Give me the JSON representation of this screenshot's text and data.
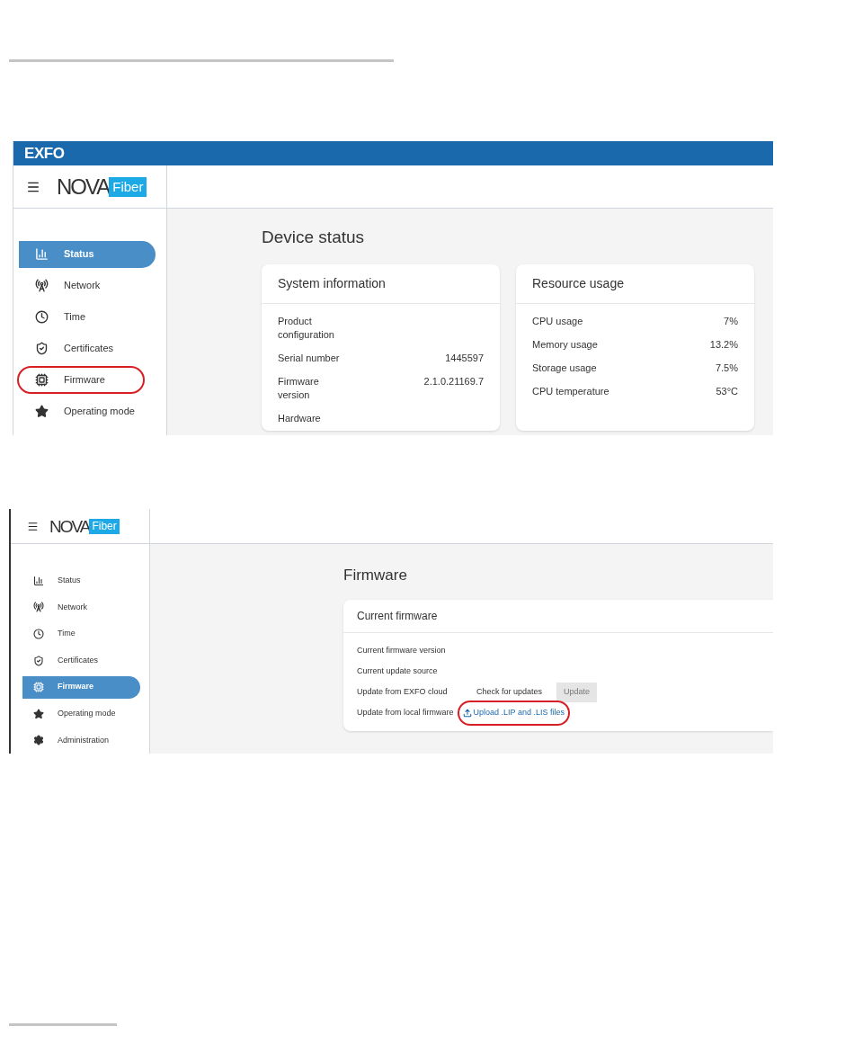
{
  "device_status_screen": {
    "brand": "EXFO",
    "logo": {
      "word": "NOVA",
      "badge": "Fiber"
    },
    "nav": [
      {
        "label": "Status",
        "kind": "chart",
        "selected": true,
        "highlighted": false
      },
      {
        "label": "Network",
        "kind": "antenna",
        "selected": false,
        "highlighted": false
      },
      {
        "label": "Time",
        "kind": "clock",
        "selected": false,
        "highlighted": false
      },
      {
        "label": "Certificates",
        "kind": "shield",
        "selected": false,
        "highlighted": false
      },
      {
        "label": "Firmware",
        "kind": "chip",
        "selected": false,
        "highlighted": true
      },
      {
        "label": "Operating mode",
        "kind": "star",
        "selected": false,
        "highlighted": false
      }
    ],
    "title": "Device status",
    "cards": [
      {
        "title": "System information",
        "rows": [
          {
            "label": "Product configuration"
          },
          {
            "label": "Serial number",
            "value": "1445597"
          },
          {
            "label": "Firmware version",
            "value": "2.1.0.21169.7"
          },
          {
            "label": "Hardware"
          }
        ]
      },
      {
        "title": "Resource usage",
        "rows": [
          {
            "label": "CPU usage",
            "value": "7%"
          },
          {
            "label": "Memory usage",
            "value": "13.2%"
          },
          {
            "label": "Storage usage",
            "value": "7.5%"
          },
          {
            "label": "CPU temperature",
            "value": "53°C"
          }
        ]
      }
    ]
  },
  "firmware_screen": {
    "logo": {
      "word": "NOVA",
      "badge": "Fiber"
    },
    "nav": [
      {
        "label": "Status",
        "kind": "chart",
        "selected": false
      },
      {
        "label": "Network",
        "kind": "antenna",
        "selected": false
      },
      {
        "label": "Time",
        "kind": "clock",
        "selected": false
      },
      {
        "label": "Certificates",
        "kind": "shield",
        "selected": false
      },
      {
        "label": "Firmware",
        "kind": "chip",
        "selected": true
      },
      {
        "label": "Operating mode",
        "kind": "star",
        "selected": false
      },
      {
        "label": "Administration",
        "kind": "gear",
        "selected": false
      }
    ],
    "title": "Firmware",
    "card": {
      "title": "Current firmware",
      "rows": [
        {
          "label": "Current firmware version",
          "kind": "text"
        },
        {
          "label": "Current update source",
          "kind": "text"
        },
        {
          "label": "Update from EXFO cloud",
          "kind": "actions",
          "actions": [
            {
              "label": "Check for updates",
              "kind": "text",
              "disabled": false
            },
            {
              "label": "Update",
              "kind": "filled",
              "disabled": true
            }
          ]
        },
        {
          "label": "Update from local firmware",
          "kind": "upload",
          "link": {
            "label": "Upload .LIP and .LIS files",
            "highlighted": true
          }
        }
      ]
    }
  }
}
